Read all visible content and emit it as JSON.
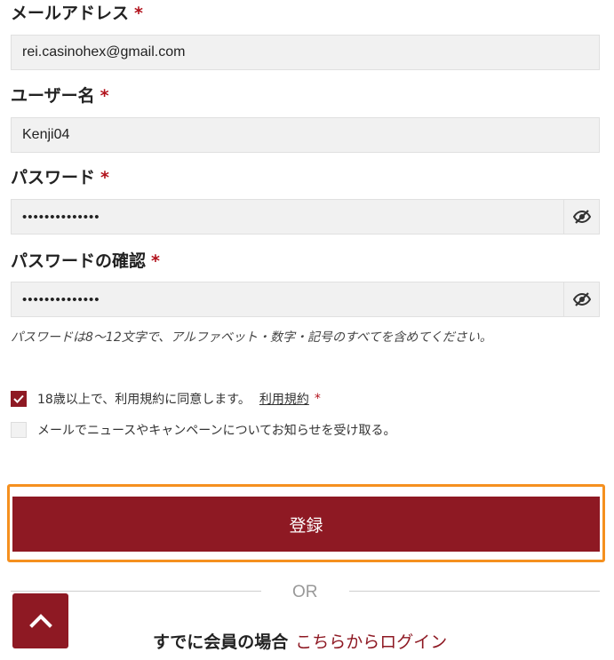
{
  "form": {
    "email": {
      "label": "メールアドレス",
      "required_mark": "*",
      "value": "rei.casinohex@gmail.com"
    },
    "username": {
      "label": "ユーザー名",
      "required_mark": "*",
      "value": "Kenji04"
    },
    "password": {
      "label": "パスワード",
      "required_mark": "*",
      "value": "••••••••••••••"
    },
    "password_confirm": {
      "label": "パスワードの確認",
      "required_mark": "*",
      "value": "••••••••••••••"
    },
    "password_hint": "パスワードは8〜12文字で、アルファベット・数字・記号のすべてを含めてください。"
  },
  "checkboxes": {
    "age_terms": {
      "text": "18歳以上で、利用規約に同意します。",
      "link": "利用規約",
      "required_mark": "*",
      "checked": true
    },
    "newsletter": {
      "text": "メールでニュースやキャンペーンについてお知らせを受け取る。",
      "checked": false
    }
  },
  "submit": {
    "label": "登録"
  },
  "divider": {
    "text": "OR"
  },
  "login": {
    "prompt": "すでに会員の場合",
    "link": "こちらからログイン"
  },
  "colors": {
    "brand": "#8e1923",
    "highlight": "#f5901f",
    "required": "#b2121c",
    "field_bg": "#f1f1f1"
  },
  "icons": {
    "password_toggle": "eye-slash-icon",
    "scroll_top": "chevron-up-icon",
    "check": "check-icon"
  }
}
